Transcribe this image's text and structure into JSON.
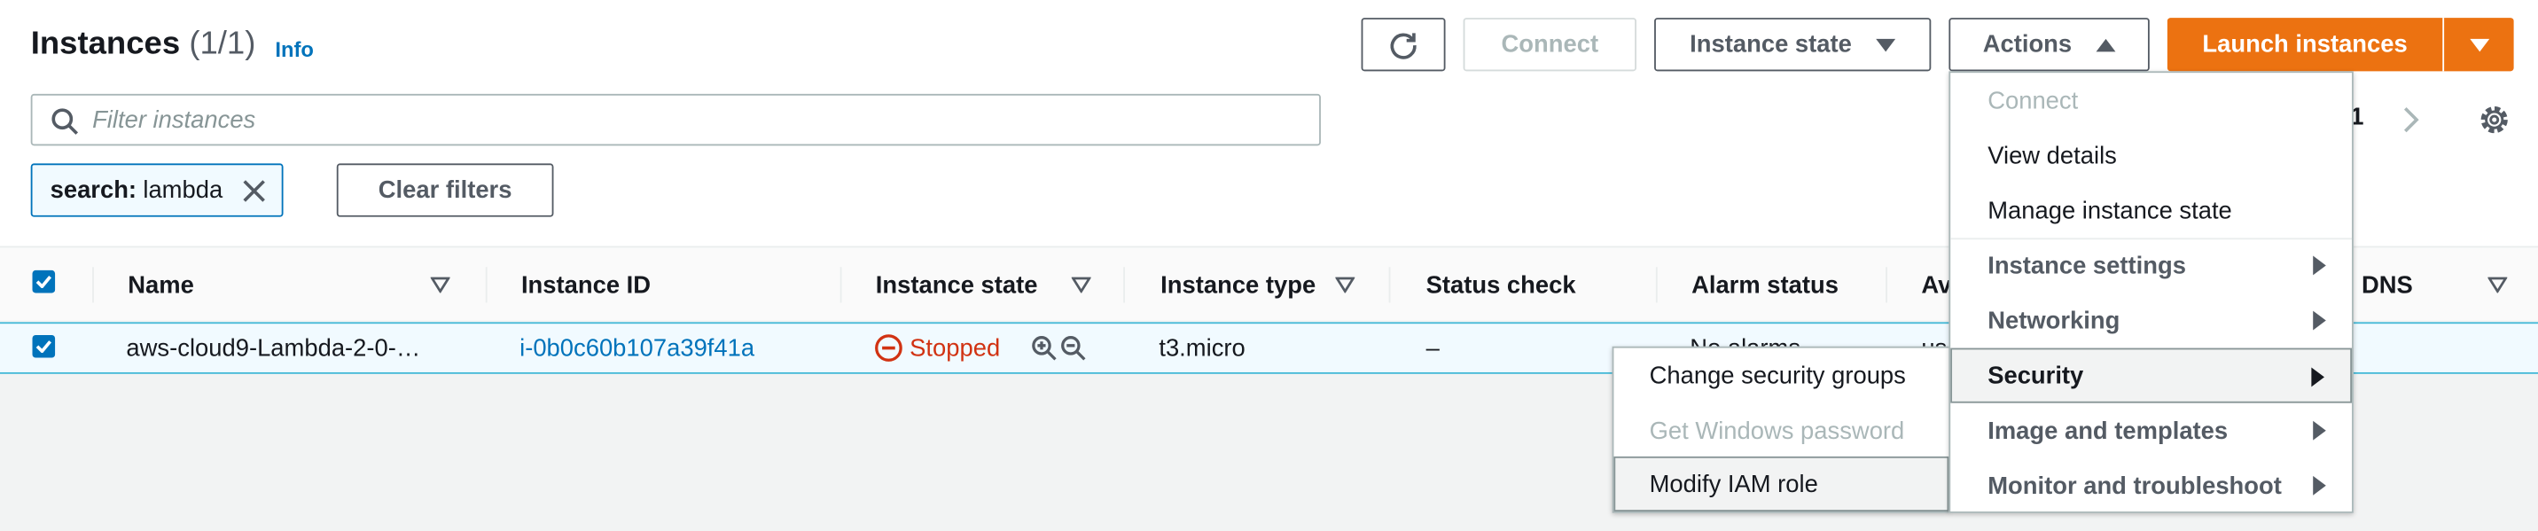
{
  "header": {
    "title": "Instances",
    "count": "(1/1)",
    "info_label": "Info"
  },
  "toolbar": {
    "connect_label": "Connect",
    "instance_state_label": "Instance state",
    "actions_label": "Actions",
    "launch_label": "Launch instances"
  },
  "search": {
    "placeholder": "Filter instances",
    "value": ""
  },
  "filter_token": {
    "key": "search:",
    "value": "lambda"
  },
  "clear_filters_label": "Clear filters",
  "pagination": {
    "page": "1"
  },
  "table": {
    "columns": [
      "Name",
      "Instance ID",
      "Instance state",
      "Instance type",
      "Status check",
      "Alarm status",
      "Av",
      "DNS"
    ],
    "rows": [
      {
        "name": "aws-cloud9-Lambda-2-0-…",
        "instance_id": "i-0b0c60b107a39f41a",
        "state": "Stopped",
        "type": "t3.micro",
        "status_check": "–",
        "alarm_status": "No alarms",
        "avail": "us"
      }
    ]
  },
  "actions_menu": {
    "items": [
      {
        "label": "Connect",
        "kind": "disabled"
      },
      {
        "label": "View details",
        "kind": "item"
      },
      {
        "label": "Manage instance state",
        "kind": "item"
      },
      {
        "label": "Instance settings",
        "kind": "group"
      },
      {
        "label": "Networking",
        "kind": "group"
      },
      {
        "label": "Security",
        "kind": "group-active"
      },
      {
        "label": "Image and templates",
        "kind": "group"
      },
      {
        "label": "Monitor and troubleshoot",
        "kind": "group"
      }
    ]
  },
  "security_submenu": {
    "items": [
      {
        "label": "Change security groups",
        "kind": "item"
      },
      {
        "label": "Get Windows password",
        "kind": "disabled"
      },
      {
        "label": "Modify IAM role",
        "kind": "active"
      }
    ]
  },
  "colors": {
    "accent": "#0073bb",
    "brand_orange": "#ec7211",
    "stopped": "#d13212",
    "selected_row": "#f1faff"
  }
}
